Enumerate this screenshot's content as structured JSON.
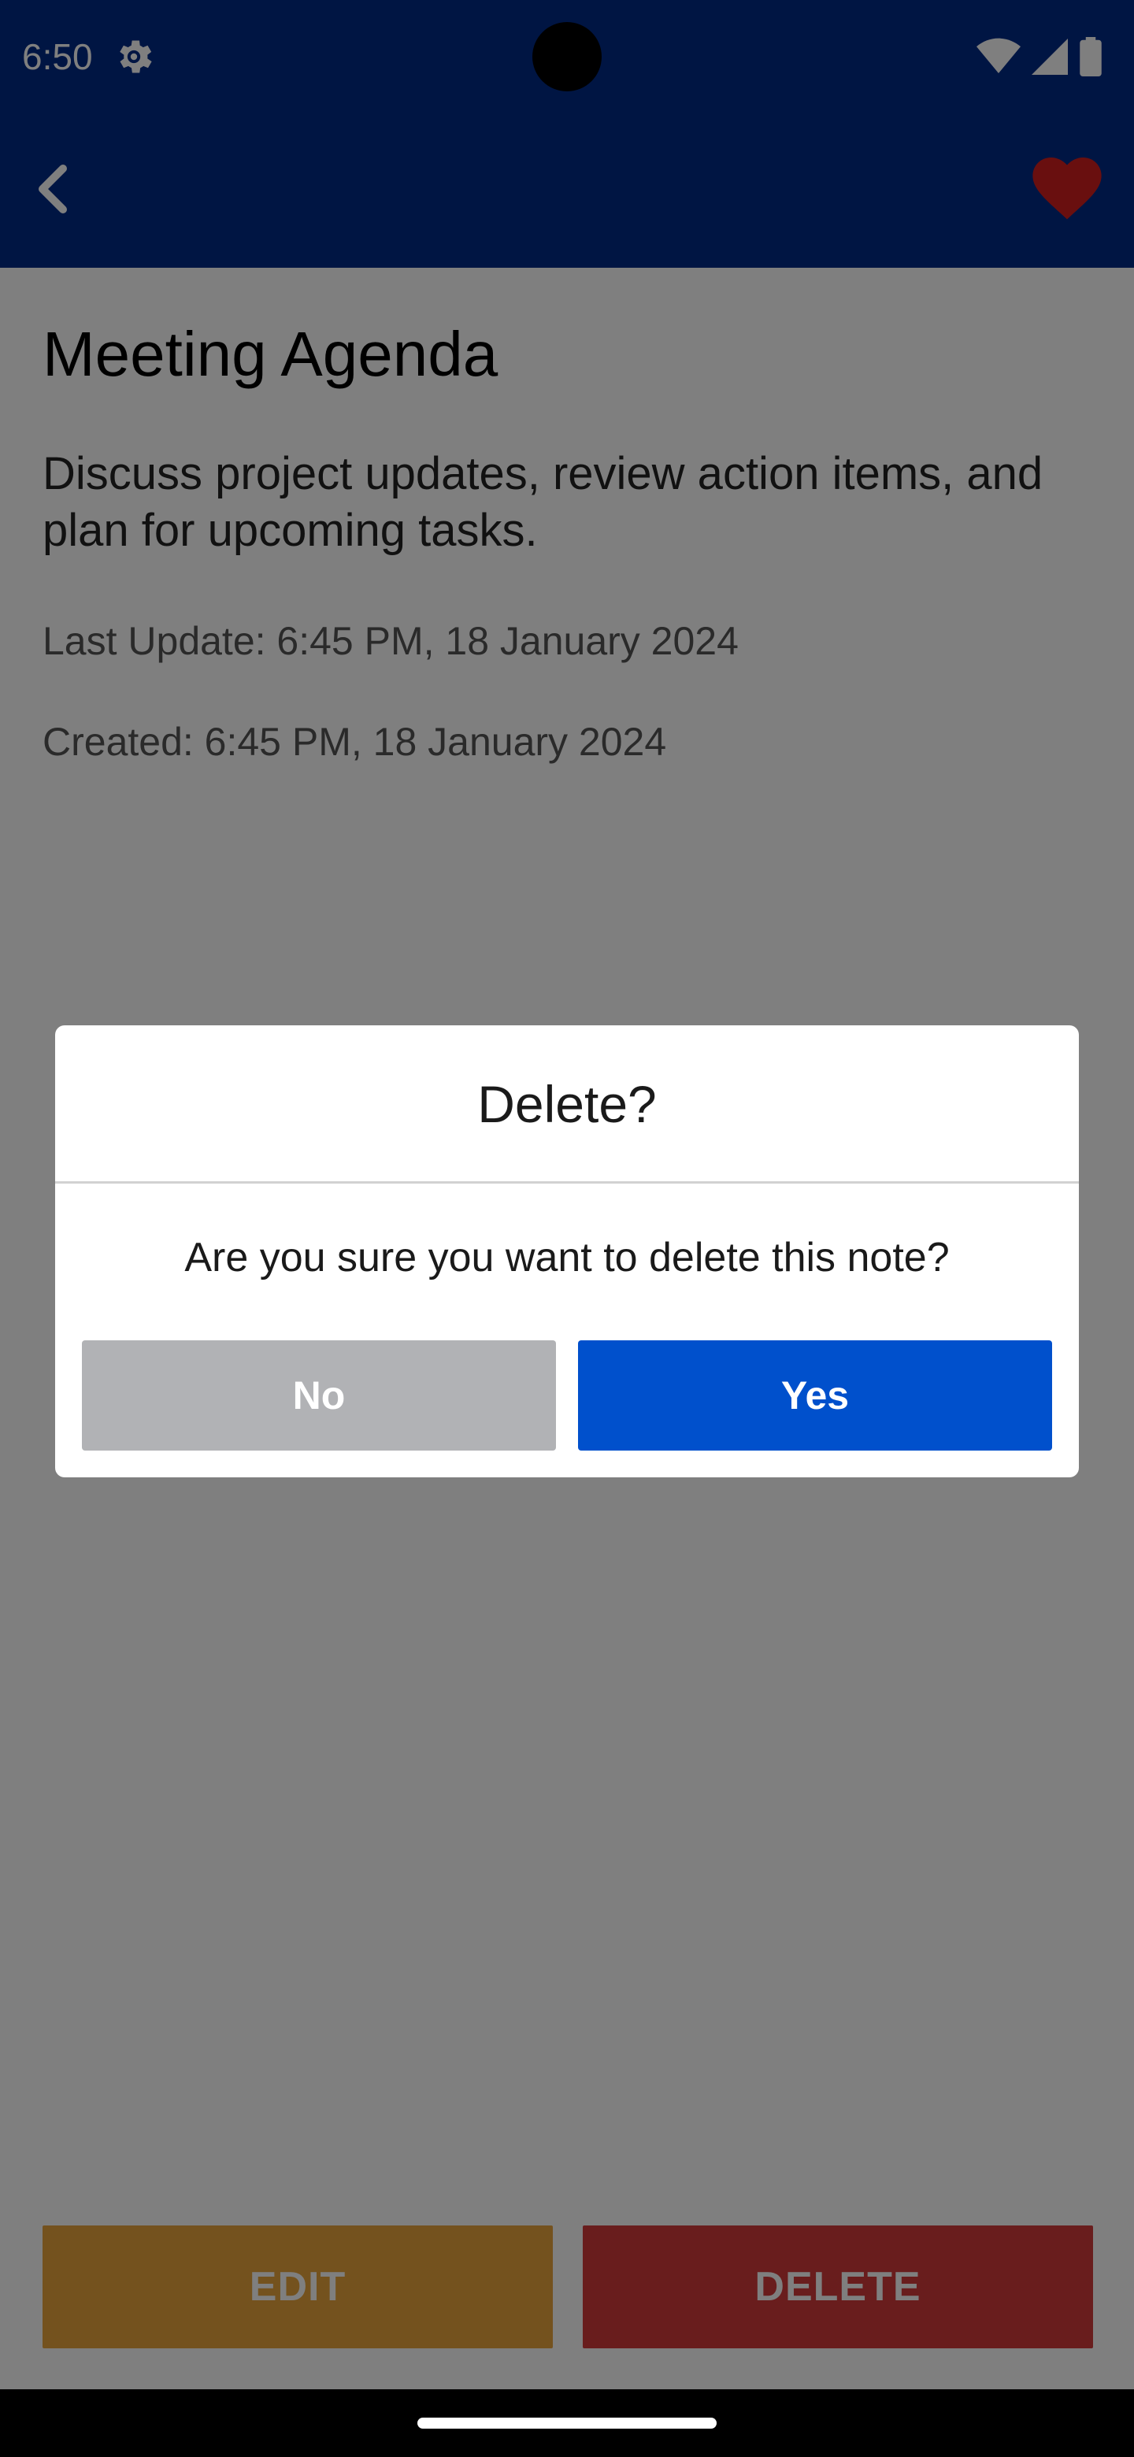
{
  "status_bar": {
    "time": "6:50",
    "icons": [
      "settings-gear-icon",
      "wifi-icon",
      "cell-signal-icon",
      "battery-icon"
    ]
  },
  "app_bar": {
    "back_icon": "chevron-left-icon",
    "favorite_icon": "heart-icon",
    "background": "#002a86",
    "favorite_color": "#d21f1f"
  },
  "note": {
    "title": "Meeting Agenda",
    "body": "Discuss project updates, review action items, and plan for upcoming tasks.",
    "last_update": "Last Update: 6:45 PM, 18 January 2024",
    "created": "Created: 6:45 PM, 18 January 2024"
  },
  "actions": {
    "edit_label": "EDIT",
    "delete_label": "DELETE",
    "edit_color": "#e9a43c",
    "delete_color": "#d33a3a"
  },
  "dialog": {
    "title": "Delete?",
    "message": "Are you sure you want to delete this note?",
    "no_label": "No",
    "yes_label": "Yes",
    "yes_color": "#0050cc",
    "no_color": "#b1b2b5"
  }
}
